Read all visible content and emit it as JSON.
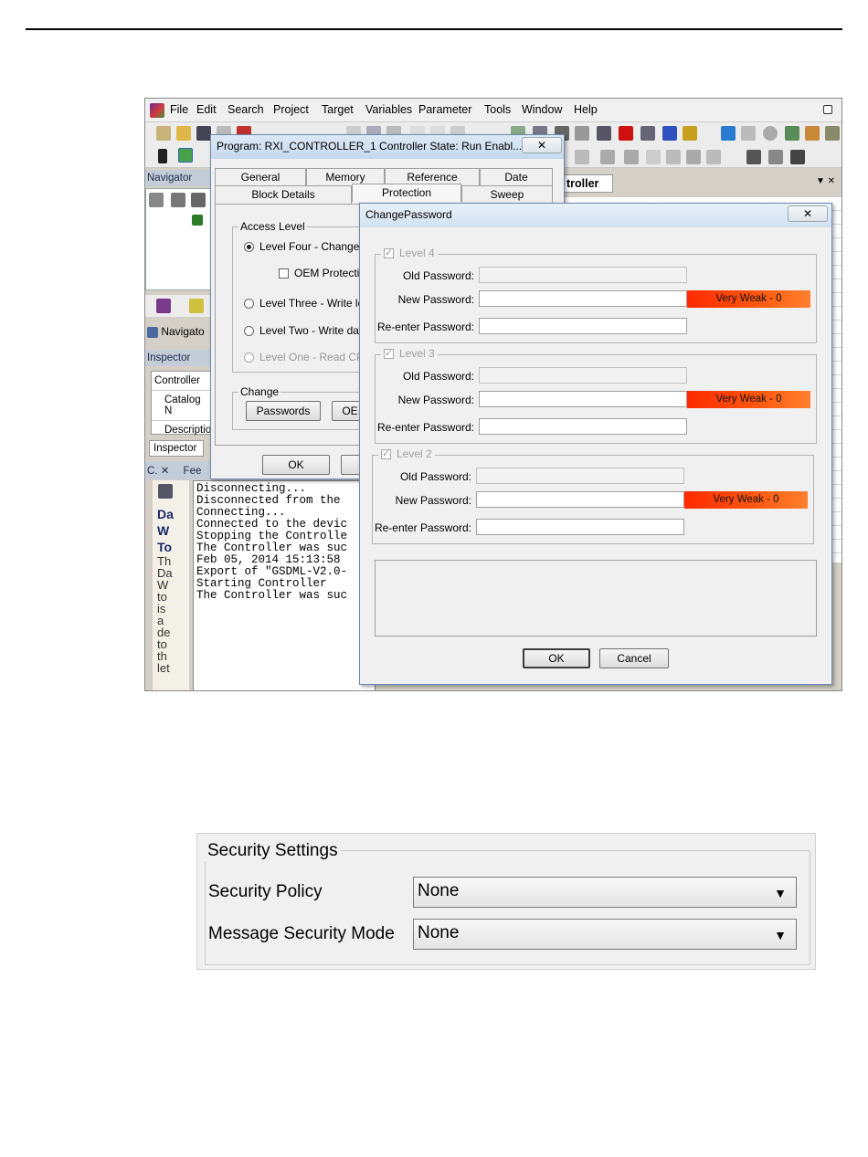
{
  "menu": [
    "File",
    "Edit",
    "Search",
    "Project",
    "Target",
    "Variables",
    "Parameter",
    "Tools",
    "Window",
    "Help"
  ],
  "navigator": {
    "title": "Navigator",
    "tab_label": "Navigato"
  },
  "inspector": {
    "title": "Inspector",
    "rows": [
      "Controller",
      "Catalog N",
      "Descriptio"
    ],
    "tab_label": "Inspector"
  },
  "feedback": {
    "title": "Fee",
    "side_text": [
      "Da",
      "W",
      "To",
      "Th",
      "Da",
      "W",
      "to",
      "is",
      "a",
      "de",
      "to",
      "th",
      "let"
    ]
  },
  "console_lines": [
    "Disconnecting...",
    "Disconnected from the",
    "Connecting...",
    "Connected to the devic",
    "Stopping the Controlle",
    "The Controller was suc",
    "Feb 05, 2014 15:13:58",
    "Export of \"GSDML-V2.0-",
    "Starting Controller",
    "The Controller was suc"
  ],
  "editor_tab": "troller",
  "program_dialog": {
    "title": "Program: RXI_CONTROLLER_1    Controller State: Run Enabl...",
    "tabs_row1": [
      "General",
      "Memory",
      "Reference",
      "Date"
    ],
    "tabs_row2": [
      "Block Details",
      "Protection",
      "Sweep"
    ],
    "access_level_label": "Access Level",
    "levels": [
      "Level Four - Change P",
      "Level Three - Write log",
      "Level Two - Write data",
      "Level One - Read CPU"
    ],
    "oem_label": "OEM Protection",
    "change_label": "Change",
    "passwords_button": "Passwords",
    "oem_button": "OE",
    "ok": "OK",
    "cancel_partial": "C"
  },
  "change_password": {
    "title": "ChangePassword",
    "close": "✕",
    "groups": [
      {
        "label": "Level 4",
        "old": "Old Password:",
        "new": "New Password:",
        "reenter": "Re-enter Password:",
        "strength": "Very Weak - 0"
      },
      {
        "label": "Level 3",
        "old": "Old Password:",
        "new": "New Password:",
        "reenter": "Re-enter Password:",
        "strength": "Very Weak - 0"
      },
      {
        "label": "Level 2",
        "old": "Old Password:",
        "new": "New Password:",
        "reenter": "Re-enter Password:",
        "strength": "Very Weak - 0"
      }
    ],
    "ok": "OK",
    "cancel": "Cancel"
  },
  "security": {
    "title": "Security Settings",
    "policy_label": "Security Policy",
    "policy_value": "None",
    "mode_label": "Message Security Mode",
    "mode_value": "None"
  }
}
